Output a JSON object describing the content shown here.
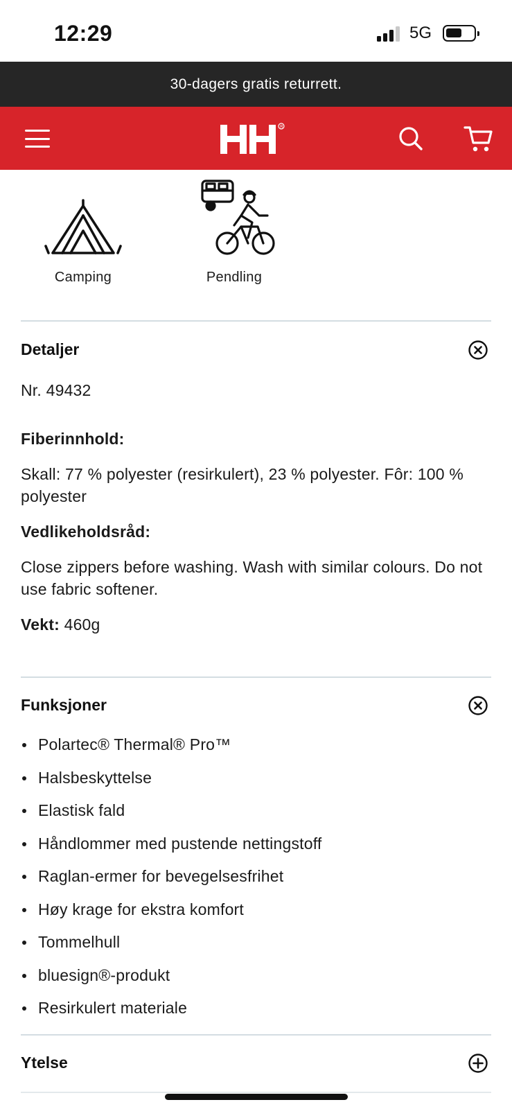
{
  "status": {
    "time": "12:29",
    "network": "5G"
  },
  "promo": {
    "text": "30-dagers gratis returrett."
  },
  "header": {
    "logo_text": "HH",
    "brand_color": "#d7242a",
    "icons": [
      "menu-icon",
      "hh-logo",
      "search-icon",
      "cart-icon"
    ]
  },
  "activities": [
    {
      "label": "Camping",
      "icon": "tent-icon"
    },
    {
      "label": "Pendling",
      "icon": "bike-commute-icon"
    }
  ],
  "details": {
    "title": "Detaljer",
    "number": "Nr. 49432",
    "fiber_label": "Fiberinnhold:",
    "fiber_value": "Skall: 77 % polyester (resirkulert), 23 % polyester. Fôr: 100 % polyester",
    "care_label": "Vedlikeholdsråd:",
    "care_value": "Close zippers before washing. Wash with similar colours. Do not use fabric softener.",
    "weight_label": "Vekt:",
    "weight_value": " 460g",
    "state": "expanded"
  },
  "features": {
    "title": "Funksjoner",
    "state": "expanded",
    "items": [
      "Polartec® Thermal® Pro™",
      "Halsbeskyttelse",
      "Elastisk fald",
      "Håndlommer med pustende nettingstoff",
      "Raglan-ermer for bevegelsesfrihet",
      "Høy krage for ekstra komfort",
      "Tommelhull",
      "bluesign®-produkt",
      "Resirkulert materiale"
    ]
  },
  "performance": {
    "title": "Ytelse",
    "state": "collapsed"
  }
}
